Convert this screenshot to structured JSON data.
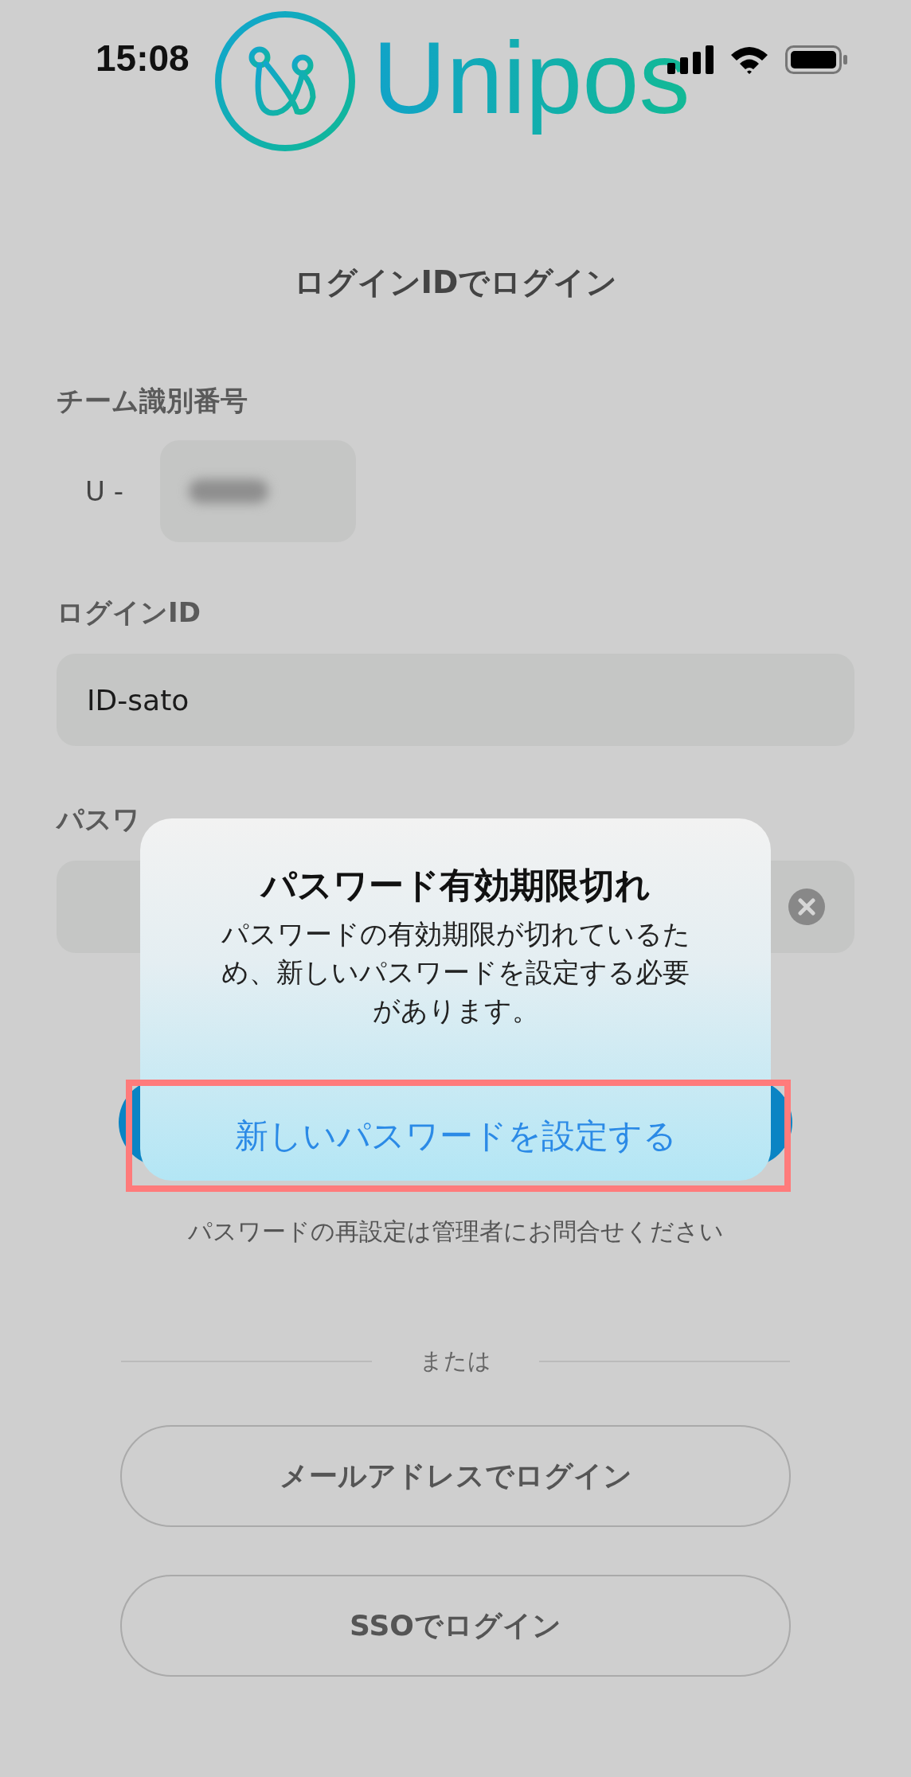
{
  "status_bar": {
    "time": "15:08"
  },
  "logo": {
    "text": "Unipos"
  },
  "title": "ログインIDでログイン",
  "team_id": {
    "label": "チーム識別番号",
    "prefix": "U -"
  },
  "login_id": {
    "label": "ログインID",
    "value": "ID-sato"
  },
  "password": {
    "label": "パスワ"
  },
  "note": "パスワードの再設定は管理者にお問合せください",
  "divider": "または",
  "alt_buttons": [
    "メールアドレスでログイン",
    "SSOでログイン"
  ],
  "dialog": {
    "title": "パスワード有効期限切れ",
    "message": "パスワードの有効期限が切れているため、新しいパスワードを設定する必要があります。",
    "action": "新しいパスワードを設定する"
  }
}
